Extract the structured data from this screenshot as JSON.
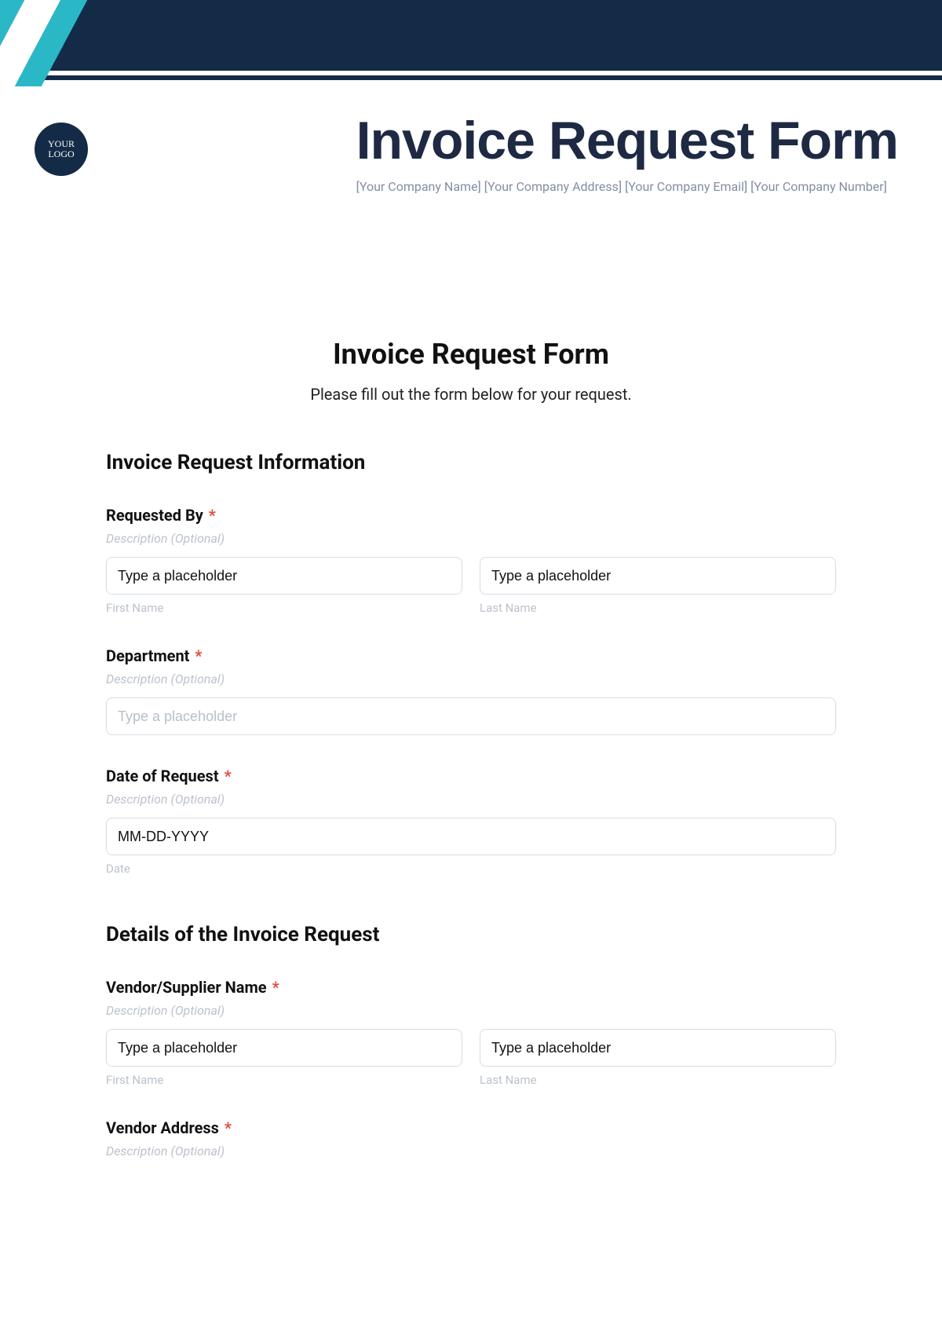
{
  "header": {
    "logo_text": "YOUR LOGO",
    "big_title": "Invoice Request Form",
    "subline": "[Your Company Name] [Your Company Address] [Your Company Email] [Your Company Number]"
  },
  "form": {
    "title": "Invoice Request Form",
    "description": "Please fill out the form below for your request.",
    "sections": [
      {
        "heading": "Invoice Request Information"
      },
      {
        "heading": "Details of the Invoice Request"
      }
    ],
    "fields": {
      "requested_by": {
        "label": "Requested By",
        "required_mark": "*",
        "desc": "Description (Optional)",
        "first": {
          "placeholder": "Type a placeholder",
          "sublabel": "First Name"
        },
        "last": {
          "placeholder": "Type a placeholder",
          "sublabel": "Last Name"
        }
      },
      "department": {
        "label": "Department",
        "required_mark": "*",
        "desc": "Description (Optional)",
        "placeholder": "Type a placeholder"
      },
      "date_of_request": {
        "label": "Date of Request",
        "required_mark": "*",
        "desc": "Description (Optional)",
        "placeholder": "MM-DD-YYYY",
        "sublabel": "Date"
      },
      "vendor_name": {
        "label": "Vendor/Supplier Name",
        "required_mark": "*",
        "desc": "Description (Optional)",
        "first": {
          "placeholder": "Type a placeholder",
          "sublabel": "First Name"
        },
        "last": {
          "placeholder": "Type a placeholder",
          "sublabel": "Last Name"
        }
      },
      "vendor_address": {
        "label": "Vendor Address",
        "required_mark": "*",
        "desc": "Description (Optional)"
      }
    }
  }
}
